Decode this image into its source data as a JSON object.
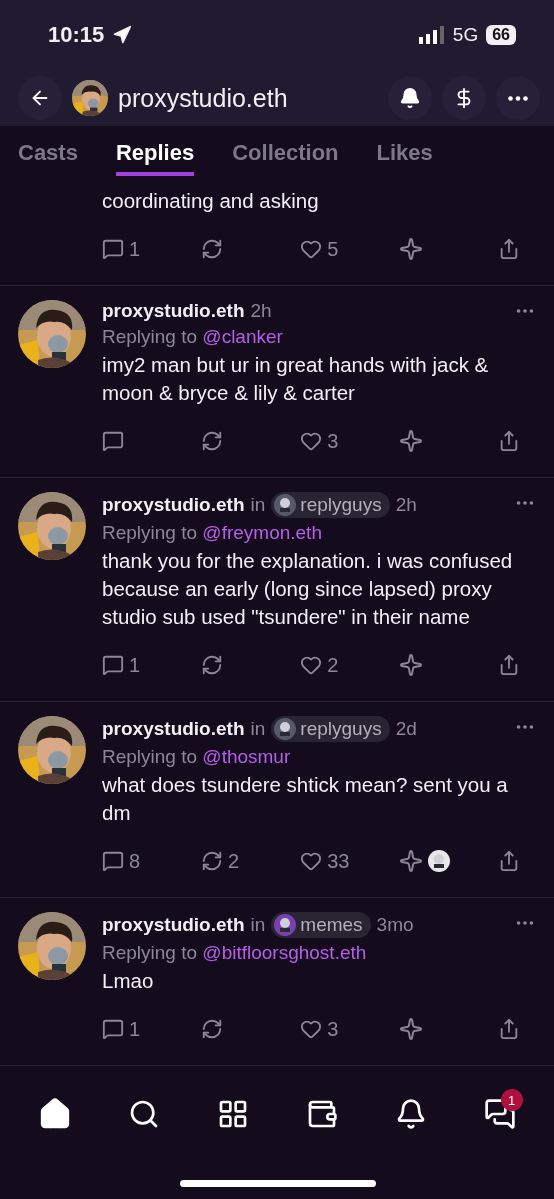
{
  "status_bar": {
    "time": "10:15",
    "network": "5G",
    "battery": "66"
  },
  "header": {
    "title": "proxystudio.eth"
  },
  "tabs": [
    {
      "label": "Casts",
      "selected": false
    },
    {
      "label": "Replies",
      "selected": true
    },
    {
      "label": "Collection",
      "selected": false
    },
    {
      "label": "Likes",
      "selected": false
    }
  ],
  "partial_post": {
    "text": "coordinating and asking",
    "reply_count": "1",
    "like_count": "5"
  },
  "posts": [
    {
      "author": "proxystudio.eth",
      "time": "2h",
      "replying_label": "Replying to",
      "replying_to": "@clanker",
      "text": "imy2 man but ur in great hands with jack & moon & bryce & lily & carter",
      "like_count": "3",
      "collected": false
    },
    {
      "author": "proxystudio.eth",
      "in": "in",
      "channel": "replyguys",
      "time": "2h",
      "replying_label": "Replying to",
      "replying_to": "@freymon.eth",
      "text": "thank you for the explanation. i was confused because an early (long since lapsed) proxy studio sub used \"tsundere\" in their name",
      "reply_count": "1",
      "like_count": "2",
      "collected": false
    },
    {
      "author": "proxystudio.eth",
      "in": "in",
      "channel": "replyguys",
      "time": "2d",
      "replying_label": "Replying to",
      "replying_to": "@thosmur",
      "text": "what does tsundere shtick mean? sent you a dm",
      "reply_count": "8",
      "recast_count": "2",
      "like_count": "33",
      "collected": true
    },
    {
      "author": "proxystudio.eth",
      "in": "in",
      "channel": "memes",
      "time": "3mo",
      "replying_label": "Replying to",
      "replying_to": "@bitfloorsghost.eth",
      "text": "Lmao",
      "reply_count": "1",
      "like_count": "3",
      "collected": false
    }
  ],
  "bottom_nav": {
    "badge": "1"
  }
}
